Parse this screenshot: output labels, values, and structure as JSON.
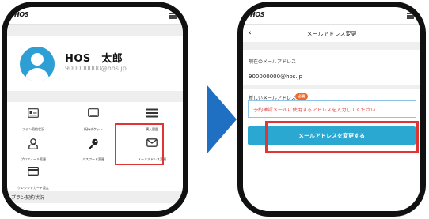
{
  "app": {
    "logo": "HOS",
    "menu_icon": "hamburger-icon"
  },
  "left_screen": {
    "user_name": "HOS　太郎",
    "user_email": "900000000@hos.jp",
    "menu_items": [
      {
        "label": "プラン契約状況",
        "icon": "contract-card-icon"
      },
      {
        "label": "所持チケット",
        "icon": "ticket-icon"
      },
      {
        "label": "購入履歴",
        "icon": "list-icon"
      },
      {
        "label": "プロフィール変更",
        "icon": "user-icon"
      },
      {
        "label": "パスワード変更",
        "icon": "key-icon"
      },
      {
        "label": "メールアドレス変更",
        "icon": "mail-icon"
      },
      {
        "label": "クレジットカード設定",
        "icon": "credit-card-icon"
      }
    ],
    "section_title": "プラン契約状況",
    "faint_text": "プラン"
  },
  "right_screen": {
    "back_symbol": "‹",
    "title": "メールアドレス変更",
    "current_label": "現在のメールアドレス",
    "current_value": "900000000@hos.jp",
    "new_label": "新しいメールアドレス",
    "required_badge": "必須",
    "input_placeholder": "予約確認メールに使用するアドレスを入力してください",
    "submit_button": "メールアドレスを変更する"
  },
  "colors": {
    "accent_blue": "#2aa8d2",
    "arrow_blue": "#1f6fc3",
    "highlight_red": "#e03535",
    "required_orange": "#f06a2a"
  }
}
